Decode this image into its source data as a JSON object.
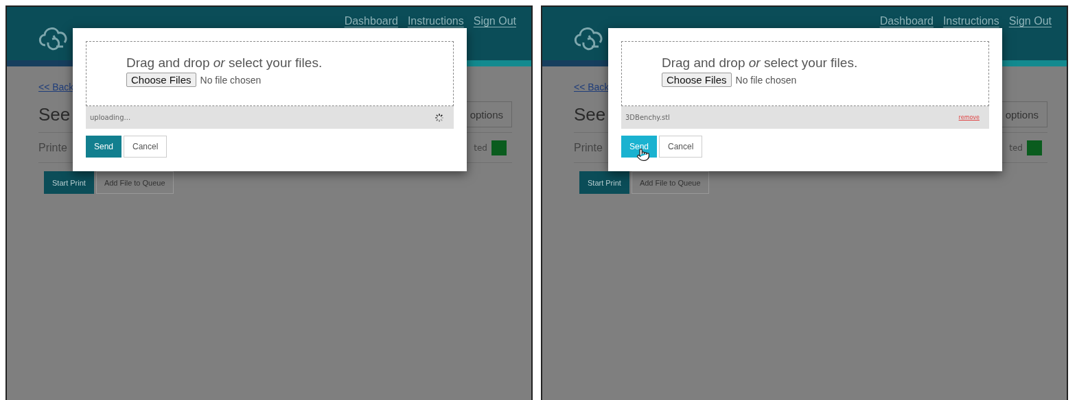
{
  "panels": [
    {
      "header": {
        "nav": [
          "Dashboard",
          "Instructions",
          "Sign Out"
        ]
      },
      "page": {
        "back_link": "<< Back",
        "title": "See",
        "options_button": "options",
        "printer_label": "Printe",
        "status": "ted",
        "actions": [
          "Start Print",
          "Add File to Queue"
        ]
      },
      "modal": {
        "prompt": "Drag and drop *or* select your files.",
        "choose_button": "Choose Files",
        "file_status": "No file chosen",
        "status_row": {
          "kind": "uploading",
          "text": "uploading..."
        },
        "send": {
          "label": "Send",
          "hovered": false
        },
        "cancel": "Cancel"
      }
    },
    {
      "header": {
        "nav": [
          "Dashboard",
          "Instructions",
          "Sign Out"
        ]
      },
      "page": {
        "back_link": "<< Back",
        "title": "See",
        "options_button": "options",
        "printer_label": "Printe",
        "status": "ted",
        "actions": [
          "Start Print",
          "Add File to Queue"
        ]
      },
      "modal": {
        "prompt": "Drag and drop *or* select your files.",
        "choose_button": "Choose Files",
        "file_status": "No file chosen",
        "status_row": {
          "kind": "file",
          "text": "3DBenchy.stl",
          "remove": "remove"
        },
        "send": {
          "label": "Send",
          "hovered": true
        },
        "cancel": "Cancel"
      }
    }
  ]
}
